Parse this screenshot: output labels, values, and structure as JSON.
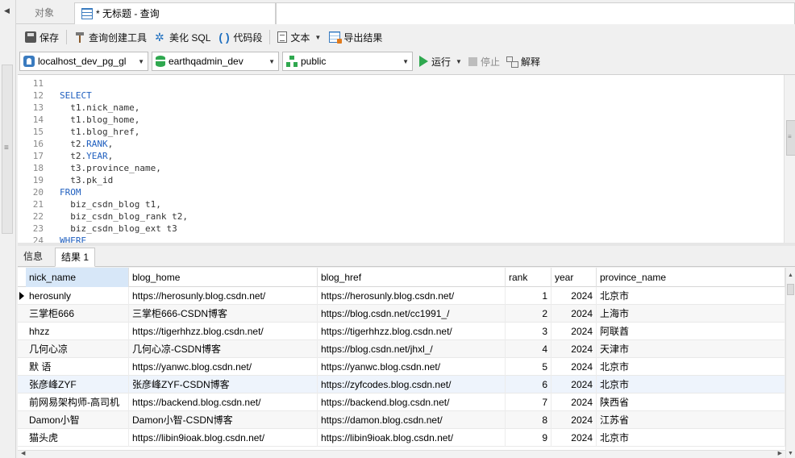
{
  "tabs": {
    "objects_label": "对象",
    "query_label": "* 无标题 - 查询"
  },
  "toolbar": {
    "save_label": "保存",
    "query_builder_label": "查询创建工具",
    "beautify_label": "美化 SQL",
    "snippet_label": "代码段",
    "text_label": "文本",
    "export_label": "导出结果"
  },
  "connection_bar": {
    "connection": "localhost_dev_pg_gl",
    "database": "earthqadmin_dev",
    "schema": "public",
    "run_label": "运行",
    "stop_label": "停止",
    "explain_label": "解释"
  },
  "editor": {
    "lines": [
      {
        "n": "11",
        "parts": [
          {
            "t": "",
            "kw": false
          }
        ]
      },
      {
        "n": "12",
        "parts": [
          {
            "t": "SELECT",
            "kw": true
          }
        ]
      },
      {
        "n": "13",
        "parts": [
          {
            "t": "  t1.nick_name,",
            "kw": false
          }
        ]
      },
      {
        "n": "14",
        "parts": [
          {
            "t": "  t1.blog_home,",
            "kw": false
          }
        ]
      },
      {
        "n": "15",
        "parts": [
          {
            "t": "  t1.blog_href,",
            "kw": false
          }
        ]
      },
      {
        "n": "16",
        "parts": [
          {
            "t": "  t2.",
            "kw": false
          },
          {
            "t": "RANK",
            "kw": true
          },
          {
            "t": ",",
            "kw": false
          }
        ]
      },
      {
        "n": "17",
        "parts": [
          {
            "t": "  t2.",
            "kw": false
          },
          {
            "t": "YEAR",
            "kw": true
          },
          {
            "t": ",",
            "kw": false
          }
        ]
      },
      {
        "n": "18",
        "parts": [
          {
            "t": "  t3.province_name,",
            "kw": false
          }
        ]
      },
      {
        "n": "19",
        "parts": [
          {
            "t": "  t3.pk_id",
            "kw": false
          }
        ]
      },
      {
        "n": "20",
        "parts": [
          {
            "t": "FROM",
            "kw": true
          }
        ]
      },
      {
        "n": "21",
        "parts": [
          {
            "t": "  biz_csdn_blog t1,",
            "kw": false
          }
        ]
      },
      {
        "n": "22",
        "parts": [
          {
            "t": "  biz_csdn_blog_rank t2,",
            "kw": false
          }
        ]
      },
      {
        "n": "23",
        "parts": [
          {
            "t": "  biz_csdn_blog_ext t3",
            "kw": false
          }
        ]
      },
      {
        "n": "24",
        "parts": [
          {
            "t": "WHERE",
            "kw": true
          }
        ]
      }
    ]
  },
  "result_tabs": {
    "info_label": "信息",
    "result_label": "结果 1"
  },
  "grid": {
    "columns": [
      "nick_name",
      "blog_home",
      "blog_href",
      "rank",
      "year",
      "province_name"
    ],
    "rows": [
      [
        "herosunly",
        "https://herosunly.blog.csdn.net/",
        "https://herosunly.blog.csdn.net/",
        "1",
        "2024",
        "北京市"
      ],
      [
        "三掌柜666",
        "三掌柜666-CSDN博客",
        "https://blog.csdn.net/cc1991_/",
        "2",
        "2024",
        "上海市"
      ],
      [
        "hhzz",
        "https://tigerhhzz.blog.csdn.net/",
        "https://tigerhhzz.blog.csdn.net/",
        "3",
        "2024",
        "阿联酋"
      ],
      [
        "几何心凉",
        "几何心凉-CSDN博客",
        "https://blog.csdn.net/jhxl_/",
        "4",
        "2024",
        "天津市"
      ],
      [
        "默 语",
        "https://yanwc.blog.csdn.net/",
        "https://yanwc.blog.csdn.net/",
        "5",
        "2024",
        "北京市"
      ],
      [
        "张彦峰ZYF",
        "张彦峰ZYF-CSDN博客",
        "https://zyfcodes.blog.csdn.net/",
        "6",
        "2024",
        "北京市"
      ],
      [
        "前网易架构师-高司机",
        "https://backend.blog.csdn.net/",
        "https://backend.blog.csdn.net/",
        "7",
        "2024",
        "陕西省"
      ],
      [
        "Damon小智",
        "Damon小智-CSDN博客",
        "https://damon.blog.csdn.net/",
        "8",
        "2024",
        "江苏省"
      ],
      [
        "猫头虎",
        "https://libin9ioak.blog.csdn.net/",
        "https://libin9ioak.blog.csdn.net/",
        "9",
        "2024",
        "北京市"
      ]
    ]
  }
}
